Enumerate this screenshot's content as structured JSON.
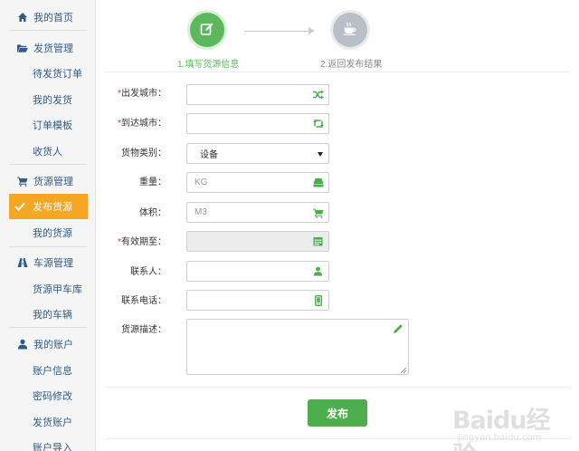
{
  "sidebar": {
    "home": "我的首页",
    "shipping": {
      "title": "发货管理",
      "items": [
        "待发货订单",
        "我的发货",
        "订单模板",
        "收货人"
      ]
    },
    "cargo": {
      "title": "货源管理",
      "active": "发布货源",
      "items": [
        "我的货源"
      ]
    },
    "vehicle": {
      "title": "车源管理",
      "items": [
        "货源甲车库",
        "我的车辆"
      ]
    },
    "account": {
      "title": "我的账户",
      "items": [
        "账户信息",
        "密码修改",
        "发货账户",
        "账户导入"
      ]
    }
  },
  "steps": {
    "step1": "1.填写货源信息",
    "step2": "2.返回发布结果"
  },
  "form": {
    "origin": {
      "label": "出发城市：",
      "required": "*",
      "value": ""
    },
    "destination": {
      "label": "到达城市：",
      "required": "*",
      "value": ""
    },
    "category": {
      "label": "货物类别：",
      "value": "设备"
    },
    "weight": {
      "label": "重量：",
      "placeholder": "KG"
    },
    "volume": {
      "label": "体积：",
      "placeholder": "M3"
    },
    "expiry": {
      "label": "有效期至：",
      "required": "*",
      "value": ""
    },
    "contact": {
      "label": "联系人：",
      "value": ""
    },
    "phone": {
      "label": "联系电话：",
      "value": ""
    },
    "description": {
      "label": "货源描述：",
      "value": ""
    }
  },
  "publish_button": "发布",
  "watermark": {
    "text": "Baidu经验",
    "url": "jingyan.baidu.com"
  },
  "colors": {
    "accent_green": "#5cb85c",
    "active_orange": "#f5a623",
    "nav_text": "#2f5b86",
    "required_red": "#d9302c"
  },
  "icons": {
    "home": "home-icon",
    "shipping": "folder-open-icon",
    "cargo": "cart-icon",
    "active": "check-icon",
    "vehicle": "road-icon",
    "account": "user-icon",
    "step1": "edit-icon",
    "step2": "coffee-icon",
    "origin": "shuffle-icon",
    "destination": "retweet-icon",
    "weight": "hdd-icon",
    "volume": "cart-icon",
    "expiry": "calendar-icon",
    "contact": "user-icon",
    "phone": "mobile-icon",
    "description": "pencil-icon"
  }
}
